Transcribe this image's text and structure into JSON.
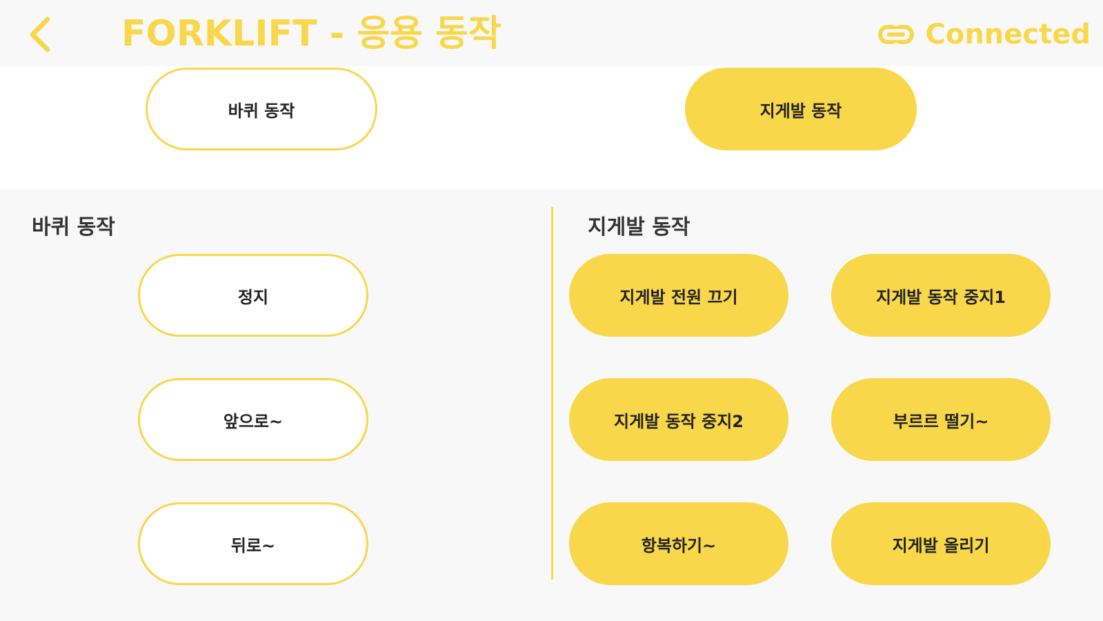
{
  "header": {
    "title": "FORKLIFT - 응용 동작",
    "connection_status": "Connected",
    "back_icon": "chevron-left-icon",
    "link_icon": "link-icon"
  },
  "mode_tabs": {
    "wheel_label": "바퀴 동작",
    "fork_label": "지게발 동작"
  },
  "wheel_section": {
    "title": "바퀴 동작",
    "buttons": [
      "정지",
      "앞으로~",
      "뒤로~"
    ]
  },
  "fork_section": {
    "title": "지게발 동작",
    "buttons": [
      "지게발 전원 끄기",
      "지게발 동작 중지1",
      "지게발 동작 중지2",
      "부르르 떨기~",
      "항복하기~",
      "지게발 올리기"
    ]
  },
  "colors": {
    "accent": "#F9D74A",
    "background": "#F8F8F8",
    "panel": "#FFFFFF",
    "text": "#222222"
  }
}
